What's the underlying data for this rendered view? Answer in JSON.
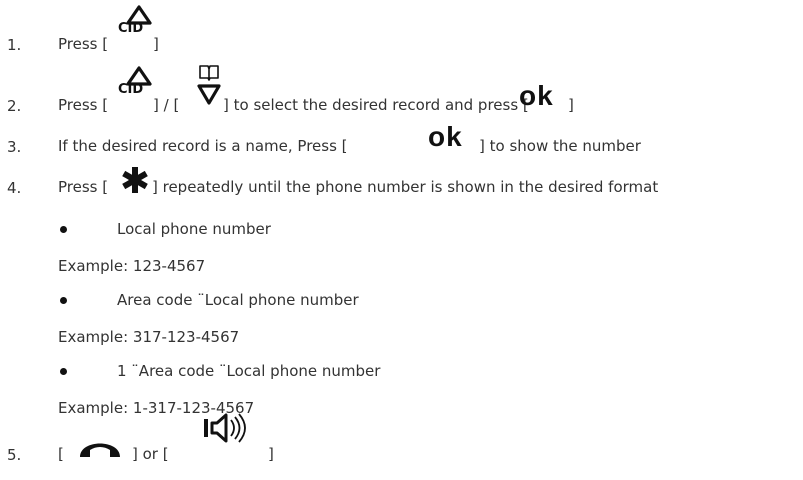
{
  "steps": [
    {
      "num": "1.",
      "t1": "Press ["
    },
    {
      "num": "2.",
      "t1": "Press [",
      "t2": "] / [",
      "t3": "] to select the desired record and press [",
      "ok": "ok",
      "t4": "]"
    },
    {
      "num": "3.",
      "t1": "If the desired record is a name, Press [",
      "ok": "ok",
      "t2": "] to show the number"
    },
    {
      "num": "4.",
      "t1": "Press [",
      "t2": "] repeatedly until the phone number is shown in the desired format"
    },
    {
      "num": "5.",
      "t1": "[",
      "t2": "] or [",
      "t3": "]"
    }
  ],
  "cid_label": "CID",
  "close_bracket": "]",
  "formats": [
    {
      "label": "Local phone number",
      "example": "Example: 123-4567"
    },
    {
      "label": "Area code ¨Local phone number",
      "example": "Example: 317-123-4567"
    },
    {
      "label": "1 ¨Area code ¨Local phone number",
      "example": "Example: 1-317-123-4567"
    }
  ],
  "icons": [
    "cid-up-icon",
    "phonebook-down-icon",
    "star-icon",
    "hang-up-icon",
    "speakerphone-icon"
  ]
}
